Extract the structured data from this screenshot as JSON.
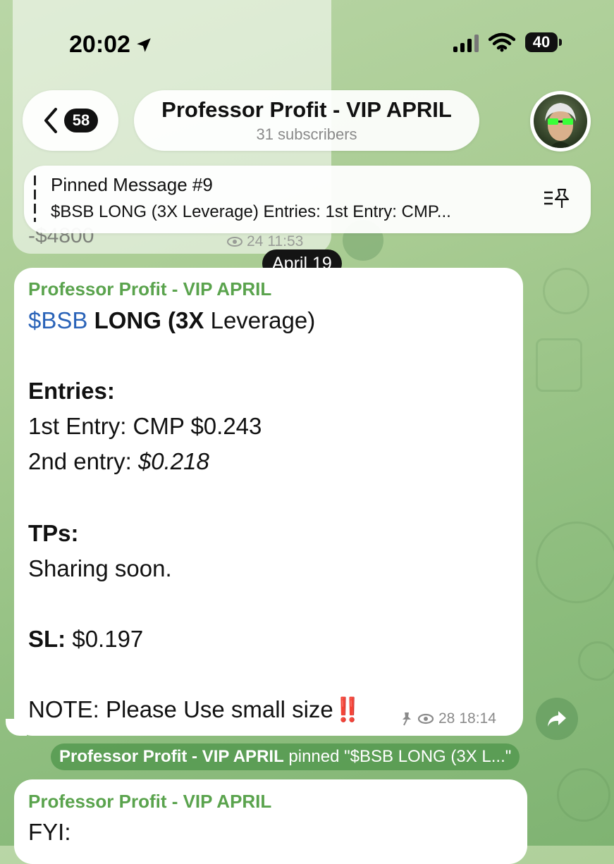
{
  "status_bar": {
    "time": "20:02",
    "battery": "40"
  },
  "header": {
    "back_count": "58",
    "title": "Professor Profit - VIP APRIL",
    "subtitle": "31 subscribers"
  },
  "previous_message": {
    "amount": "-$4800",
    "views": "24",
    "time": "11:53"
  },
  "pinned": {
    "title": "Pinned Message #9",
    "text": "$BSB LONG (3X Leverage) Entries: 1st Entry: CMP..."
  },
  "date_chip": "April 19",
  "message": {
    "sender": "Professor Profit - VIP APRIL",
    "ticker": "$BSB",
    "long_label": "LONG (3X",
    "leverage_suffix": "Leverage)",
    "entries_label": "Entries:",
    "entry1": "1st Entry: CMP $0.243",
    "entry2_label": "2nd entry:",
    "entry2_value": "$0.218",
    "tps_label": "TPs:",
    "tps_text": "Sharing soon.",
    "sl_label": "SL:",
    "sl_value": "$0.197",
    "note": "NOTE: Please Use small size",
    "note_emoji": "‼️",
    "views": "28",
    "time": "18:14"
  },
  "service_message": {
    "actor": "Professor Profit - VIP APRIL",
    "text": "pinned \"$BSB LONG (3X L...\""
  },
  "next_message": {
    "sender": "Professor Profit - VIP APRIL",
    "text": "FYI:"
  },
  "colors": {
    "sender": "#5aa34d",
    "ticker": "#2a63b8",
    "service_bg": "#50964b"
  }
}
